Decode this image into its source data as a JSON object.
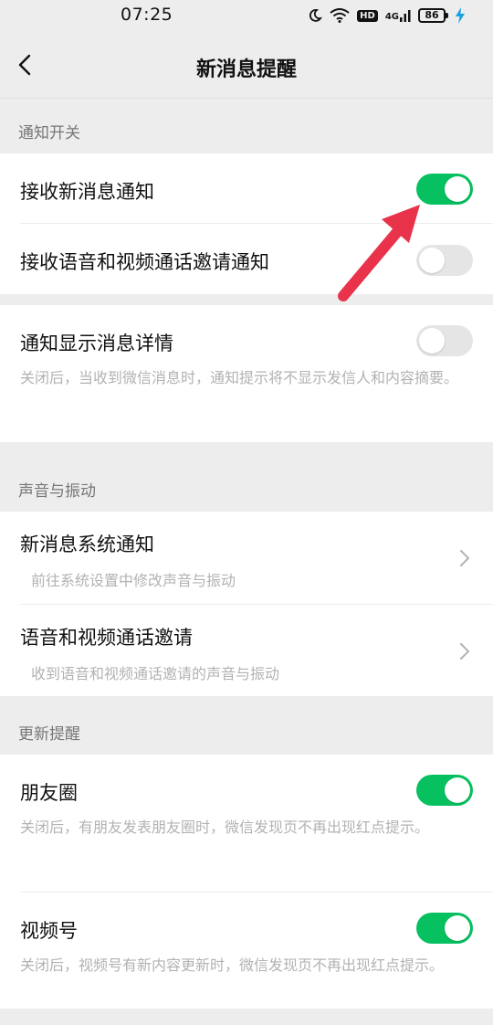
{
  "status_bar": {
    "time": "07:25",
    "hd_label": "HD",
    "network_label": "4G",
    "battery_level": "86",
    "icons": [
      "moon-icon",
      "wifi-icon",
      "hd-icon",
      "4g-signal-icon",
      "battery-icon",
      "charging-icon"
    ]
  },
  "nav": {
    "back_icon": "chevron-left-icon",
    "title": "新消息提醒"
  },
  "sections": {
    "notify": {
      "header": "通知开关",
      "receive_new_label": "接收新消息通知",
      "receive_new_on": true,
      "receive_call_label": "接收语音和视频通话邀请通知",
      "receive_call_on": false
    },
    "detail": {
      "label": "通知显示消息详情",
      "on": false,
      "desc": "关闭后，当收到微信消息时，通知提示将不显示发信人和内容摘要。"
    },
    "sound": {
      "header": "声音与振动",
      "system_label": "新消息系统通知",
      "system_desc": "前往系统设置中修改声音与振动",
      "call_label": "语音和视频通话邀请",
      "call_desc": "收到语音和视频通话邀请的声音与振动"
    },
    "updates": {
      "header": "更新提醒",
      "moments_label": "朋友圈",
      "moments_on": true,
      "moments_desc": "关闭后，有朋友发表朋友圈时，微信发现页不再出现红点提示。",
      "channels_label": "视频号",
      "channels_on": true,
      "channels_desc": "关闭后，视频号有新内容更新时，微信发现页不再出现红点提示。"
    }
  },
  "colors": {
    "toggle_on": "#07c160",
    "toggle_off": "#e5e5e5",
    "annotation_arrow": "#e8334a",
    "background": "#ededed"
  }
}
